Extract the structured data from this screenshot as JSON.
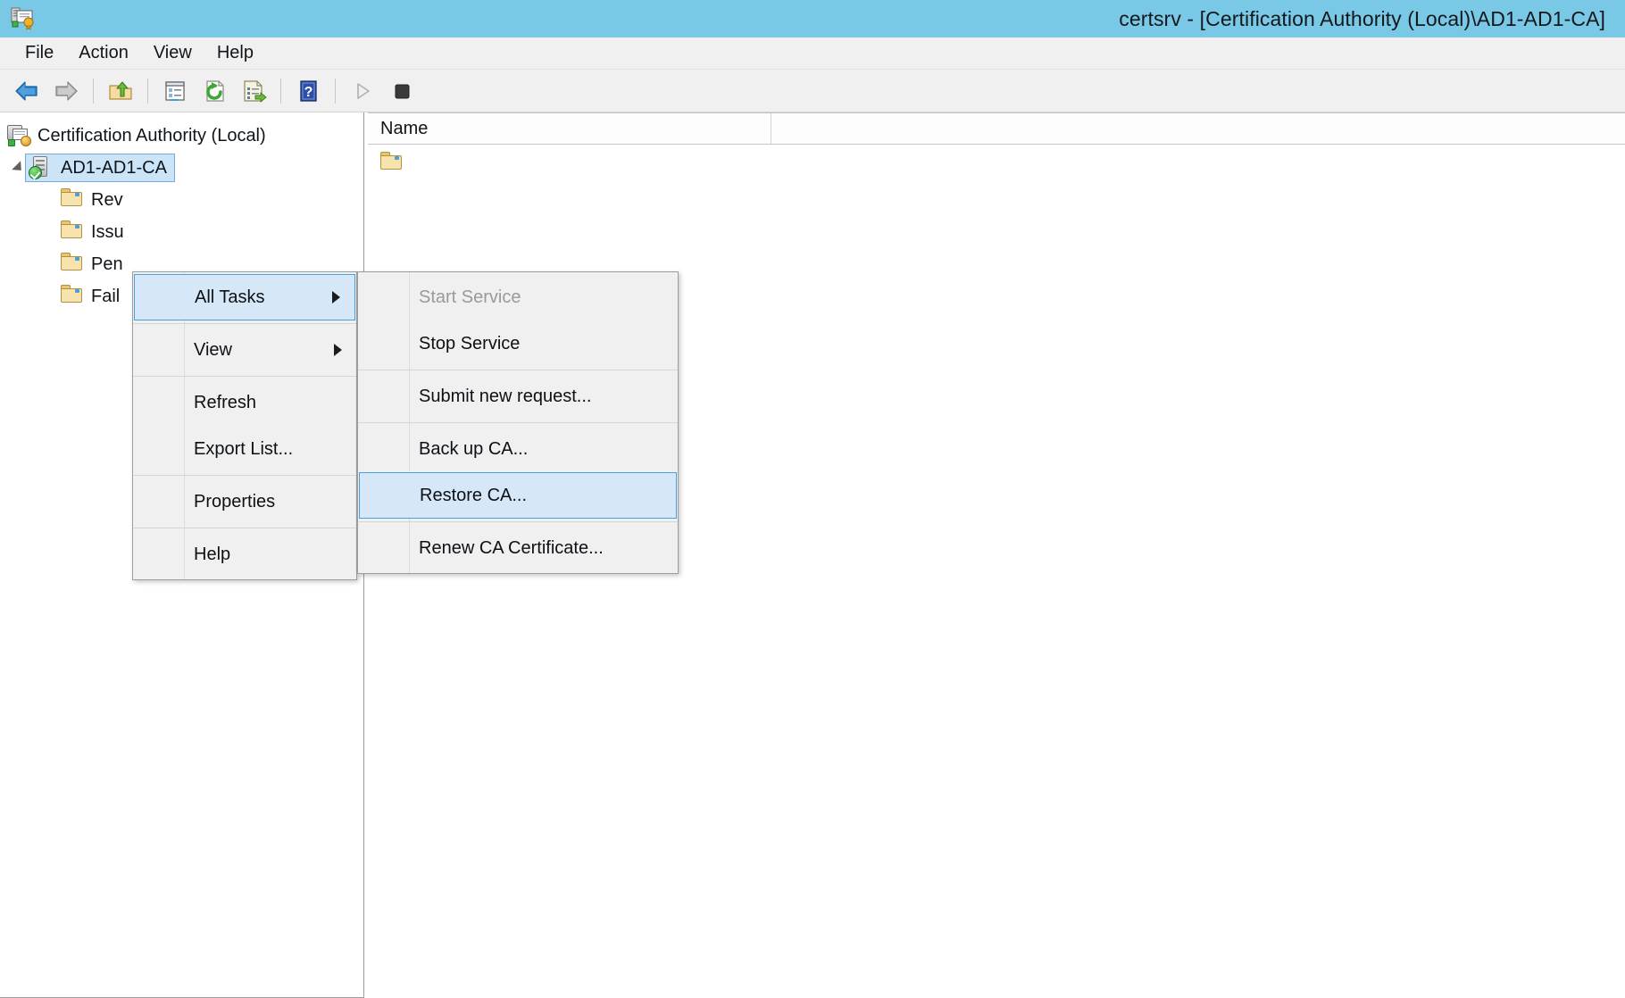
{
  "window": {
    "title": "certsrv - [Certification Authority (Local)\\AD1-AD1-CA]",
    "icon": "certsrv-icon",
    "titlebar_color": "#79c8e5"
  },
  "menubar": {
    "items": [
      {
        "label": "File",
        "name": "menubar-item-file"
      },
      {
        "label": "Action",
        "name": "menubar-item-action"
      },
      {
        "label": "View",
        "name": "menubar-item-view"
      },
      {
        "label": "Help",
        "name": "menubar-item-help"
      }
    ]
  },
  "toolbar": {
    "buttons": [
      {
        "icon": "back-arrow-icon",
        "enabled": true
      },
      {
        "icon": "forward-arrow-icon",
        "enabled": false
      },
      {
        "icon": "up-folder-icon",
        "enabled": true
      },
      {
        "icon": "properties-icon",
        "enabled": true
      },
      {
        "icon": "refresh-icon",
        "enabled": true
      },
      {
        "icon": "export-list-icon",
        "enabled": true
      },
      {
        "icon": "help-icon",
        "enabled": true
      },
      {
        "icon": "start-service-play-icon",
        "enabled": false
      },
      {
        "icon": "stop-service-square-icon",
        "enabled": true
      }
    ]
  },
  "tree": {
    "root": {
      "label": "Certification Authority (Local)",
      "icon": "certification-authority-icon"
    },
    "ca_node": {
      "label": "AD1-AD1-CA",
      "icon": "ca-server-running-icon",
      "selected": true,
      "expanded": true
    },
    "children": [
      {
        "label": "Rev",
        "full_label": "Revoked Certificates",
        "icon": "folder-icon"
      },
      {
        "label": "Issu",
        "full_label": "Issued Certificates",
        "icon": "folder-icon"
      },
      {
        "label": "Pen",
        "full_label": "Pending Requests",
        "icon": "folder-icon"
      },
      {
        "label": "Fail",
        "full_label": "Failed Requests",
        "icon": "folder-icon"
      }
    ]
  },
  "list": {
    "columns": [
      {
        "label": "Name",
        "name": "list-column-name"
      },
      {
        "label": "",
        "name": "list-column-blank"
      }
    ],
    "rows": [
      {
        "label": "",
        "icon": "folder-icon",
        "obscured": true
      }
    ]
  },
  "context_menu": {
    "name": "ca-context-menu",
    "items": [
      {
        "label": "All Tasks",
        "submenu": true,
        "highlighted": true,
        "disabled": false
      },
      {
        "separator": true
      },
      {
        "label": "View",
        "submenu": true,
        "highlighted": false,
        "disabled": false
      },
      {
        "separator": true
      },
      {
        "label": "Refresh",
        "submenu": false,
        "highlighted": false,
        "disabled": false
      },
      {
        "label": "Export List...",
        "submenu": false,
        "highlighted": false,
        "disabled": false
      },
      {
        "separator": true
      },
      {
        "label": "Properties",
        "submenu": false,
        "highlighted": false,
        "disabled": false
      },
      {
        "separator": true
      },
      {
        "label": "Help",
        "submenu": false,
        "highlighted": false,
        "disabled": false
      }
    ]
  },
  "submenu": {
    "name": "all-tasks-submenu",
    "items": [
      {
        "label": "Start Service",
        "disabled": true,
        "highlighted": false
      },
      {
        "label": "Stop Service",
        "disabled": false,
        "highlighted": false
      },
      {
        "separator": true
      },
      {
        "label": "Submit new request...",
        "disabled": false,
        "highlighted": false
      },
      {
        "separator": true
      },
      {
        "label": "Back up CA...",
        "disabled": false,
        "highlighted": false
      },
      {
        "label": "Restore CA...",
        "disabled": false,
        "highlighted": true
      },
      {
        "separator": true
      },
      {
        "label": "Renew CA Certificate...",
        "disabled": false,
        "highlighted": false
      }
    ]
  },
  "colors": {
    "titlebar": "#79c8e5",
    "chrome": "#f0f0f0",
    "selection_fill": "#cce4f7",
    "selection_border": "#7aa8d0",
    "menu_highlight_fill": "#d6e8f8",
    "menu_highlight_border": "#4a9edc",
    "disabled_text": "#9a9a9a"
  }
}
